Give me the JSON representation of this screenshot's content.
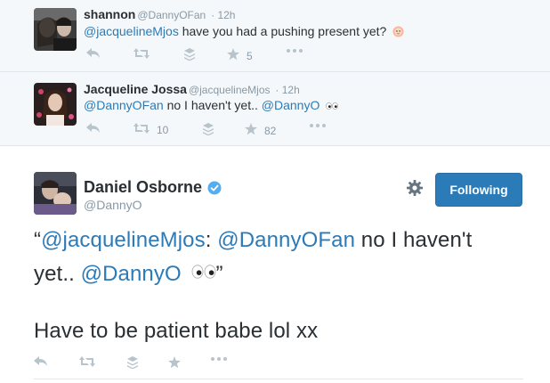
{
  "tweet1": {
    "name": "shannon",
    "handle": "@DannyOFan",
    "time": "· 12h",
    "mention": "@jacquelineMjos",
    "text": " have you had a pushing present yet?",
    "emoji": "baby-face",
    "actions": {
      "reply": "",
      "retweet": "",
      "favorite_count": "5"
    }
  },
  "tweet2": {
    "name": "Jacqueline Jossa",
    "handle": "@jacquelineMjos",
    "time": "· 12h",
    "mention1": "@DannyOFan",
    "text1": " no I haven't yet.. ",
    "mention2": "@DannyO",
    "emoji": "eyes",
    "actions": {
      "retweet_count": "10",
      "favorite_count": "82"
    }
  },
  "main": {
    "name": "Daniel Osborne",
    "handle": "@DannyO",
    "follow_label": "Following",
    "quote_open": "“",
    "mention1": "@jacquelineMjos",
    "colon": ": ",
    "mention2": "@DannyOFan",
    "text1": " no I haven't",
    "text2": "yet.. ",
    "mention3": "@DannyO",
    "quote_close": "”",
    "body": "Have to be patient babe lol xx"
  },
  "colors": {
    "link": "#2b7bb9",
    "follow_bg": "#2b7bb9",
    "verified": "#55acee",
    "muted": "#8899a6",
    "icon": "#b8c4cc",
    "reply_bg": "#f5f8fa"
  }
}
